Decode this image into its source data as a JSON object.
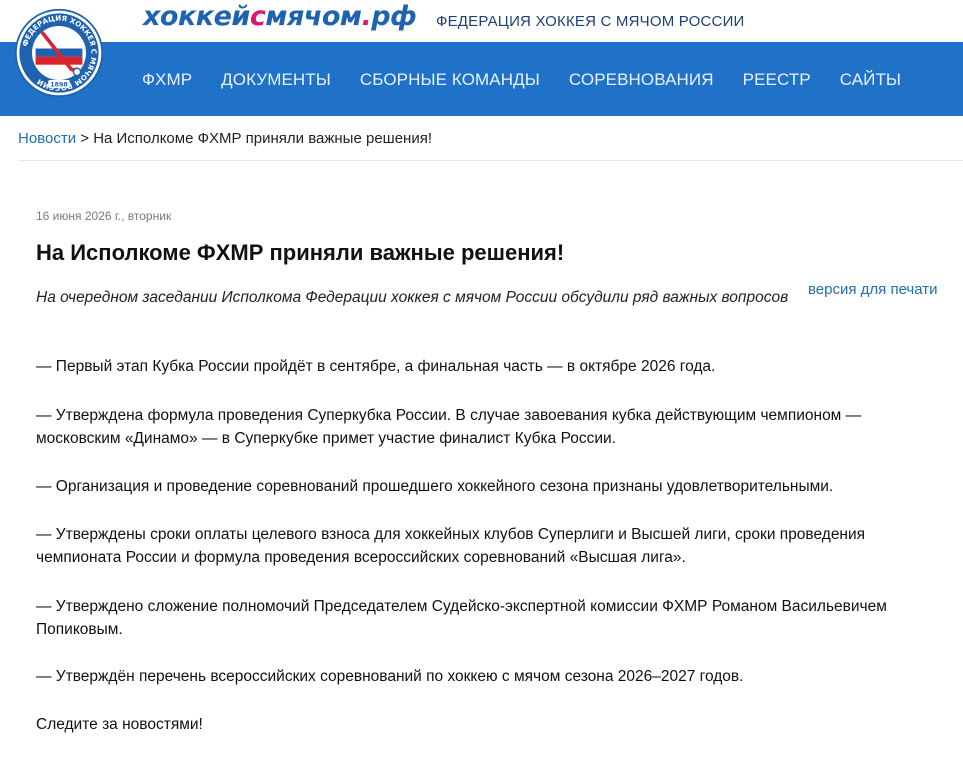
{
  "header": {
    "site_name_part1": "хоккей",
    "site_name_c": "с",
    "site_name_part2": "мячом",
    "site_name_dot": ".",
    "site_name_tld": "рф",
    "tagline": "ФЕДЕРАЦИЯ ХОККЕЯ С МЯЧОМ РОССИИ",
    "logo": {
      "ring_text": "ФЕДЕРАЦИЯ ХОККЕЯ С МЯЧОМ РОССИИ",
      "year": "1898"
    },
    "nav": [
      "ФХМР",
      "ДОКУМЕНТЫ",
      "СБОРНЫЕ КОМАНДЫ",
      "СОРЕВНОВАНИЯ",
      "РЕЕСТР",
      "САЙТЫ"
    ]
  },
  "breadcrumb": {
    "link": "Новости",
    "separator": ">",
    "current": "На Исполкоме ФХМР приняли важные решения!"
  },
  "article": {
    "date": "16 июня 2026 г., вторник",
    "title": "На Исполкоме ФХМР приняли важные решения!",
    "print_link": "версия для печати",
    "lead": "На очередном заседании Исполкома Федерации хоккея с мячом России обсудили ряд важных вопросов",
    "paragraphs": [
      "— Первый этап Кубка России пройдёт в сентябре, а финальная часть — в октябре 2026 года.",
      "— Утверждена формула проведения Суперкубка России. В случае завоевания кубка действующим чемпионом — московским «Динамо» — в Суперкубке примет участие финалист Кубка России.",
      "— Организация и проведение соревнований прошедшего хоккейного сезона признаны удовлетворительными.",
      "— Утверждены сроки оплаты целевого взноса для хоккейных клубов Суперлиги и Высшей лиги, сроки проведения чемпионата России и формула проведения всероссийских соревнований «Высшая лига».",
      "— Утверждено сложение полномочий Председателем Судейско-экспертной комиссии ФХМР Романом Васильевичем Попиковым.",
      "— Утверждён перечень всероссийских соревнований по хоккею с мячом сезона 2026–2027 годов.",
      "Следите за новостями!"
    ]
  },
  "colors": {
    "nav_background": "#1f72c7",
    "link": "#1f6fb5",
    "brand_blue": "#1f63b0",
    "brand_accent": "#e0186c"
  }
}
